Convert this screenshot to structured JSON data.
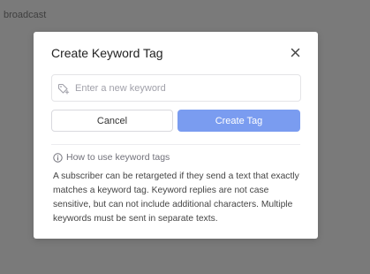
{
  "background": {
    "text": "broadcast"
  },
  "modal": {
    "title": "Create Keyword Tag",
    "close_icon": "close-icon",
    "input": {
      "placeholder": "Enter a new keyword",
      "value": "",
      "icon": "tag-plus-icon"
    },
    "cancel_label": "Cancel",
    "create_label": "Create Tag",
    "help": {
      "icon": "info-icon",
      "link_text": "How to use keyword tags",
      "body": "A subscriber can be retargeted if they send a text that exactly matches a keyword tag. Keyword replies are not case sensitive, but can not include additional characters. Multiple keywords must be sent in separate texts."
    }
  },
  "colors": {
    "overlay": "#7a7a7a",
    "primary_button": "#7a9cf0",
    "modal_background": "#ffffff"
  }
}
